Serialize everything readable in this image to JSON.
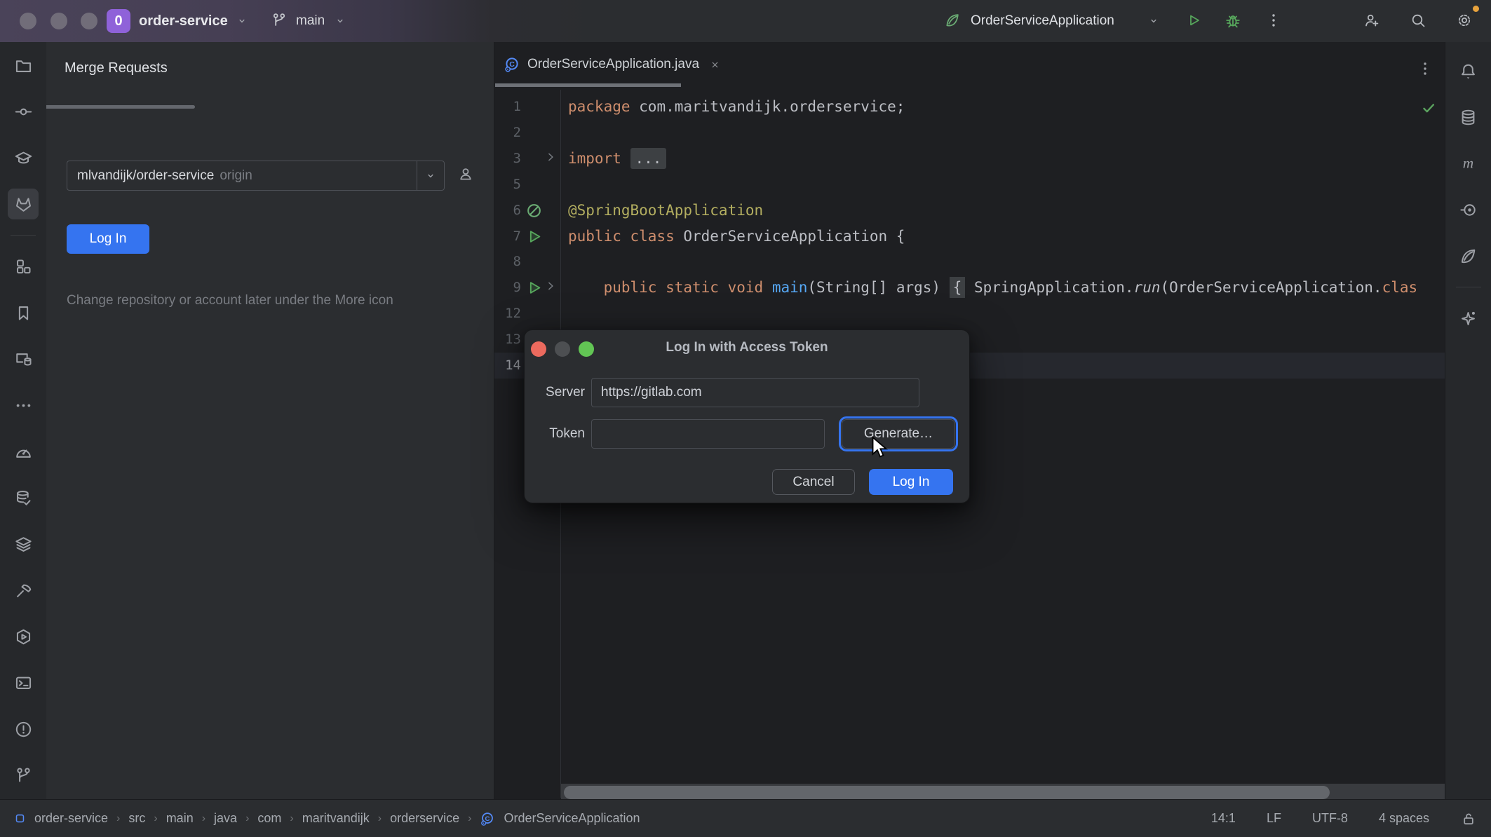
{
  "titlebar": {
    "project_badge": "0",
    "project_name": "order-service",
    "branch_name": "main",
    "run_config": "OrderServiceApplication"
  },
  "left_strip": {
    "items": [
      {
        "icon": "folder",
        "name": "project"
      },
      {
        "icon": "commit",
        "name": "commit"
      },
      {
        "icon": "learn",
        "name": "learn"
      },
      {
        "icon": "gitlab",
        "name": "gitlab-merge-requests",
        "selected": true
      },
      {
        "divider": true
      },
      {
        "icon": "structure",
        "name": "structure"
      },
      {
        "icon": "bookmarks",
        "name": "bookmarks"
      },
      {
        "icon": "device-db",
        "name": "database-changes"
      },
      {
        "icon": "more-h",
        "name": "more-tool-windows"
      },
      {
        "icon": "profiler",
        "name": "profiler"
      },
      {
        "icon": "db-check",
        "name": "data-sources"
      },
      {
        "icon": "layers",
        "name": "layers"
      },
      {
        "icon": "build",
        "name": "build"
      },
      {
        "icon": "services",
        "name": "services"
      },
      {
        "icon": "terminal",
        "name": "terminal"
      },
      {
        "icon": "problems",
        "name": "problems"
      },
      {
        "icon": "git",
        "name": "version-control"
      }
    ]
  },
  "right_strip": {
    "items": [
      {
        "icon": "notifications",
        "name": "notifications"
      },
      {
        "icon": "database",
        "name": "database"
      },
      {
        "icon": "maven",
        "name": "maven"
      },
      {
        "icon": "endpoints",
        "name": "endpoints"
      },
      {
        "icon": "spring",
        "name": "spring"
      },
      {
        "divider": true
      },
      {
        "icon": "ai",
        "name": "ai-assistant"
      }
    ]
  },
  "toolwindow": {
    "title": "Merge Requests",
    "combo_value": "mlvandijk/order-service",
    "combo_suffix": "origin",
    "login_button": "Log In",
    "hint": "Change repository or account later under the More icon"
  },
  "editor": {
    "tab_label": "OrderServiceApplication.java",
    "rows": [
      {
        "num": "1",
        "tokens": [
          [
            "kw",
            "package"
          ],
          [
            "pl",
            " com.maritvandijk.orderservice;"
          ]
        ]
      },
      {
        "num": "2",
        "tokens": []
      },
      {
        "num": "3",
        "fold": true,
        "tokens": [
          [
            "kw",
            "import"
          ],
          [
            "pl",
            " "
          ],
          [
            "fold",
            "..."
          ]
        ]
      },
      {
        "num": "5",
        "tokens": []
      },
      {
        "num": "6",
        "gutter": "bean",
        "tokens": [
          [
            "ann",
            "@SpringBootApplication"
          ]
        ]
      },
      {
        "num": "7",
        "gutter": "run",
        "tokens": [
          [
            "kw",
            "public class"
          ],
          [
            "pl",
            " OrderServiceApplication {"
          ]
        ]
      },
      {
        "num": "8",
        "tokens": []
      },
      {
        "num": "9",
        "gutter": "run",
        "fold": true,
        "tokens": [
          [
            "pl",
            "    "
          ],
          [
            "kw",
            "public static void"
          ],
          [
            "pl",
            " "
          ],
          [
            "fn",
            "main"
          ],
          [
            "pl",
            "(String[] args) "
          ],
          [
            "brace",
            "{"
          ],
          [
            "pl",
            " SpringApplication."
          ],
          [
            "it",
            "run"
          ],
          [
            "pl",
            "(OrderServiceApplication."
          ],
          [
            "kw",
            "clas"
          ]
        ]
      },
      {
        "num": "12",
        "tokens": []
      },
      {
        "num": "13",
        "tokens": [
          [
            "pl",
            "}"
          ]
        ]
      },
      {
        "num": "14",
        "caret": true,
        "tokens": []
      }
    ]
  },
  "dialog": {
    "title": "Log In with Access Token",
    "server_label": "Server",
    "server_value": "https://gitlab.com",
    "token_label": "Token",
    "token_value": "",
    "generate_button": "Generate…",
    "cancel_button": "Cancel",
    "login_button": "Log In"
  },
  "statusbar": {
    "breadcrumbs": [
      "order-service",
      "src",
      "main",
      "java",
      "com",
      "maritvandijk",
      "orderservice",
      "OrderServiceApplication"
    ],
    "caret_position": "14:1",
    "line_ending": "LF",
    "encoding": "UTF-8",
    "indent": "4 spaces"
  },
  "colors": {
    "accent": "#3574F0",
    "keyword": "#CF8E6D",
    "annotation": "#B3AE60",
    "method": "#56A8F5",
    "plain": "#BCBEC4",
    "run_green": "#57A75C",
    "badge_purple": "#8F62D9",
    "notification_dot": "#E8A33D"
  }
}
